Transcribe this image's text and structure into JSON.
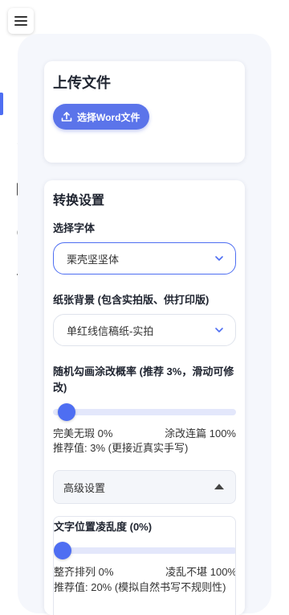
{
  "upload": {
    "title": "上传文件",
    "button_label": "选择Word文件"
  },
  "settings": {
    "title": "转换设置",
    "font": {
      "label": "选择字体",
      "selected": "栗壳坚坚体"
    },
    "paper": {
      "label": "纸张背景 (包含实拍版、供打印版)",
      "selected": "单红线信稿纸-实拍"
    },
    "doodle": {
      "label": "随机勾画涂改概率 (推荐 3%，滑动可修改)",
      "value_percent": 3,
      "min_label": "完美无瑕 0%",
      "max_label": "涂改连篇 100%",
      "hint": "推荐值: 3% (更接近真实手写)"
    },
    "advanced": {
      "label": "高级设置",
      "position_chaos": {
        "label": "文字位置凌乱度 (0%)",
        "value_percent": 0,
        "min_label": "整齐排列 0%",
        "max_label": "凌乱不堪 100%",
        "hint": "推荐值: 20% (模拟自然书写不规则性)"
      }
    }
  },
  "nav": {
    "items": [
      "home-icon",
      "star-icon",
      "book-icon",
      "help-icon",
      "send-icon"
    ],
    "active": "home-icon"
  },
  "colors": {
    "accent": "#4e6ef2",
    "button": "#5b74ea"
  }
}
